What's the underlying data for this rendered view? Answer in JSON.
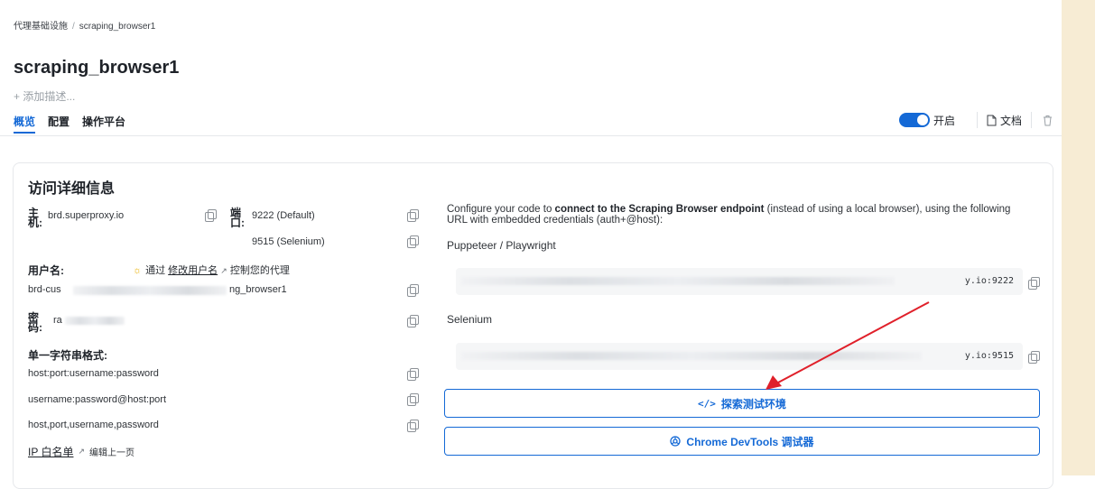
{
  "breadcrumb": {
    "parent": "代理基础设施",
    "current": "scraping_browser1"
  },
  "title": "scraping_browser1",
  "add_description": "+ 添加描述...",
  "tabs": [
    {
      "label": "概览",
      "active": true
    },
    {
      "label": "配置",
      "active": false
    },
    {
      "label": "操作平台",
      "active": false
    }
  ],
  "toolbar": {
    "toggle_label": "开启",
    "toggle_on": true,
    "docs_label": "文档"
  },
  "card": {
    "title": "访问详细信息",
    "host_label": "主机:",
    "host_value": "brd.superproxy.io",
    "port_label": "端口:",
    "port_default": "9222 (Default)",
    "port_selenium": "9515 (Selenium)",
    "username_label": "用户名:",
    "username_hint": {
      "prefix": "通过",
      "link": "修改用户名",
      "suffix": "控制您的代理"
    },
    "username_value_prefix": "brd-cus",
    "username_value_suffix": "ng_browser1",
    "password_label": "密码:",
    "password_value_prefix": "ra",
    "string_format_label": "单一字符串格式:",
    "formats": [
      "host:port:username:password",
      "username:password@host:port",
      "host,port,username,password"
    ],
    "ip_whitelist_label": "IP 白名单",
    "edit_prev_label": "编辑上一页",
    "desc_prefix": "Configure your code to ",
    "desc_bold": "connect to the Scraping Browser endpoint",
    "desc_suffix": " (instead of using a local browser), using the following URL with embedded credentials (auth+@host):",
    "puppeteer_label": "Puppeteer / Playwright",
    "puppeteer_url_tail": "y.io:9222",
    "selenium_label": "Selenium",
    "selenium_url_tail": "y.io:9515",
    "explore_button": "探索测试环境",
    "explore_icon": "</>",
    "devtools_button": "Chrome DevTools 调试器"
  },
  "colors": {
    "accent": "#1469d6",
    "annotation_arrow": "#e0202a",
    "scrollbar": "#f7ecd4"
  }
}
